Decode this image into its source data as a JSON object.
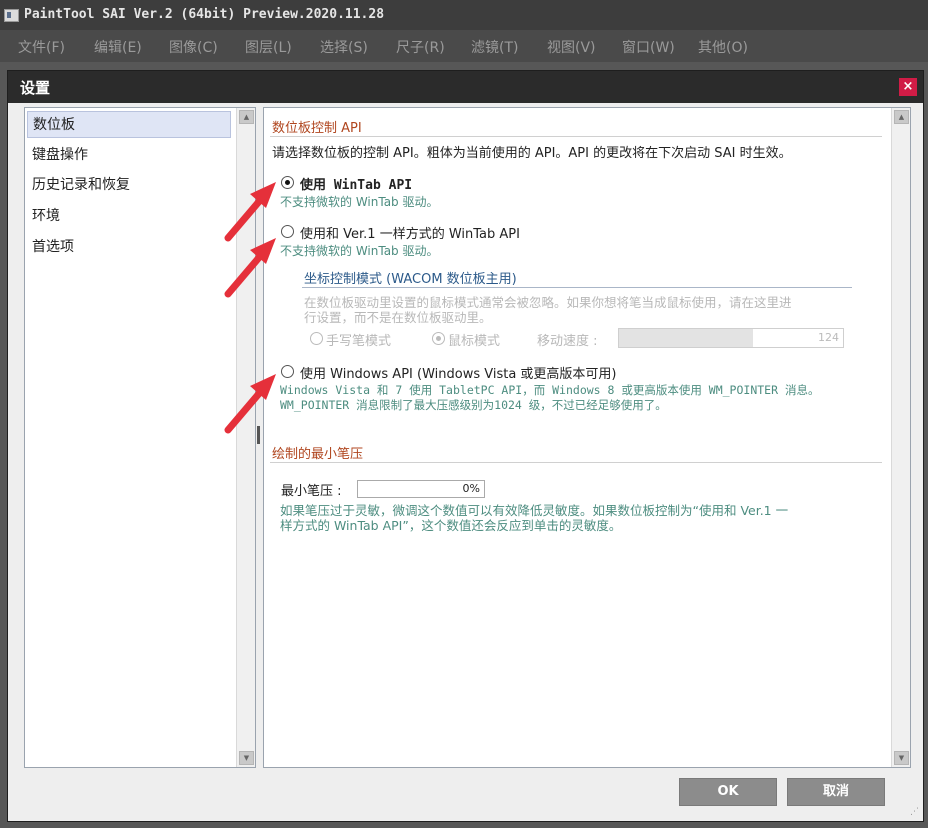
{
  "window": {
    "title": "PaintTool SAI Ver.2 (64bit) Preview.2020.11.28"
  },
  "menu": [
    "文件(F)",
    "编辑(E)",
    "图像(C)",
    "图层(L)",
    "选择(S)",
    "尺子(R)",
    "滤镜(T)",
    "视图(V)",
    "窗口(W)",
    "其他(O)"
  ],
  "dialog": {
    "title": "设置",
    "close": "×",
    "sidebar": [
      "数位板",
      "键盘操作",
      "历史记录和恢复",
      "环境",
      "首选项"
    ],
    "tablet": {
      "section_title": "数位板控制 API",
      "intro": "请选择数位板的控制 API。粗体为当前使用的 API。API 的更改将在下次启动 SAI 时生效。",
      "option1_label": "使用 WinTab API",
      "option1_desc": "不支持微软的 WinTab 驱动。",
      "option2_label": "使用和 Ver.1 一样方式的 WinTab API",
      "option2_desc": "不支持微软的 WinTab 驱动。",
      "coord_title": "坐标控制模式 (WACOM 数位板主用)",
      "coord_desc1": "在数位板驱动里设置的鼠标模式通常会被忽略。如果你想将笔当成鼠标使用，请在这里进",
      "coord_desc2": "行设置，而不是在数位板驱动里。",
      "pen_mode": "手写笔模式",
      "mouse_mode": "鼠标模式",
      "move_speed_label": "移动速度 :",
      "move_speed_value": "124",
      "move_speed_fill": 0.6,
      "option3_label": "使用 Windows API (Windows Vista 或更高版本可用)",
      "option3_desc1": "Windows Vista 和 7 使用 TabletPC API，而 Windows 8 或更高版本使用 WM_POINTER 消息。",
      "option3_desc2": "WM_POINTER 消息限制了最大压感级别为1024 级，不过已经足够使用了。"
    },
    "pressure": {
      "section_title": "绘制的最小笔压",
      "label": "最小笔压 :",
      "value": "0%",
      "desc1": "如果笔压过于灵敏，微调这个数值可以有效降低灵敏度。如果数位板控制为“使用和 Ver.1 一",
      "desc2": "样方式的 WinTab API”，这个数值还会反应到单击的灵敏度。"
    },
    "ok": "OK",
    "cancel": "取消"
  },
  "colors": {
    "accent_arrow": "#e5303a",
    "section_title": "#b0461f",
    "desc_text": "#4d8d80",
    "close_button": "#d01c46"
  }
}
